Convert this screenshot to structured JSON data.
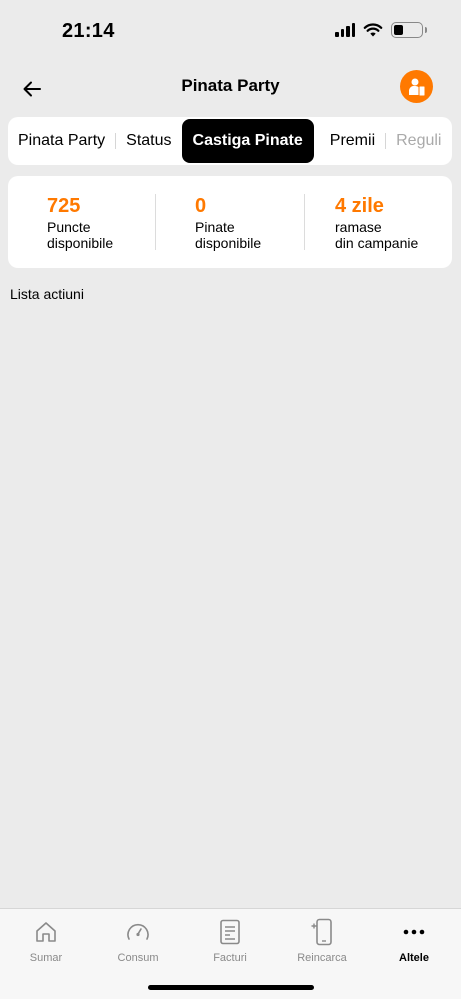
{
  "status_bar": {
    "time": "21:14"
  },
  "header": {
    "title": "Pinata Party"
  },
  "tabs": [
    {
      "label": "Pinata Party",
      "active": false
    },
    {
      "label": "Status",
      "active": false
    },
    {
      "label": "Castiga Pinate",
      "active": true
    },
    {
      "label": "Premii",
      "active": false
    },
    {
      "label": "Reguli",
      "active": false
    }
  ],
  "stats": [
    {
      "value": "725",
      "label_line1": "Puncte",
      "label_line2": "disponibile"
    },
    {
      "value": "0",
      "label_line1": "Pinate",
      "label_line2": "disponibile"
    },
    {
      "value": "4 zile",
      "label_line1": "ramase",
      "label_line2": "din campanie"
    }
  ],
  "section": {
    "title": "Lista actiuni"
  },
  "bottom_nav": [
    {
      "label": "Sumar",
      "icon": "home-icon",
      "active": false
    },
    {
      "label": "Consum",
      "icon": "gauge-icon",
      "active": false
    },
    {
      "label": "Facturi",
      "icon": "invoice-icon",
      "active": false
    },
    {
      "label": "Reincarca",
      "icon": "phone-topup-icon",
      "active": false
    },
    {
      "label": "Altele",
      "icon": "more-dots-icon",
      "active": true
    }
  ],
  "colors": {
    "accent": "#ff7900",
    "background": "#ebebeb",
    "card": "#ffffff"
  }
}
